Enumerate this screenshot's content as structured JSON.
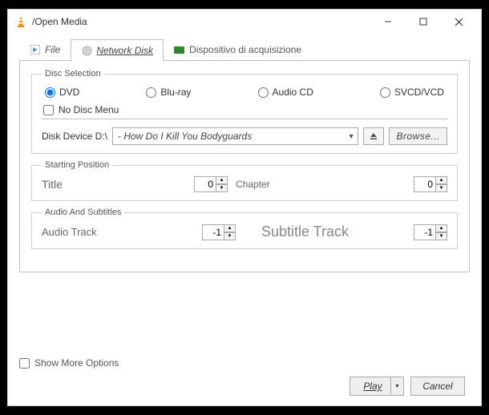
{
  "window": {
    "title": "/Open Media"
  },
  "tabs": {
    "file": "File",
    "disc": "Network Disk",
    "capture": "Dispositivo di acquisizione"
  },
  "disc_selection": {
    "legend": "Disc Selection",
    "options": [
      "DVD",
      "Blu-ray",
      "Audio CD",
      "SVCD/VCD"
    ],
    "no_menu": "No Disc Menu",
    "device_label": "Disk Device D:\\",
    "device_value": "- How Do I Kill You Bodyguards",
    "browse": "Browse..."
  },
  "start_pos": {
    "legend": "Starting Position",
    "title_label": "Title",
    "title_value": "0",
    "chapter_label": "Chapter",
    "chapter_value": "0"
  },
  "audio_sub": {
    "legend": "Audio And Subtitles",
    "audio_label": "Audio Track",
    "audio_value": "-1",
    "subtitle_label": "Subtitle Track",
    "subtitle_value": "-1"
  },
  "footer": {
    "show_more": "Show More Options",
    "play": "Play",
    "cancel": "Cancel"
  }
}
